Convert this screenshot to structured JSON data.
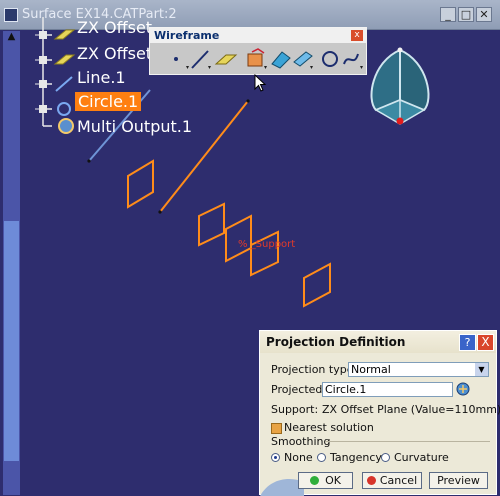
{
  "window": {
    "title": "Surface EX14.CATPart:2"
  },
  "tree": {
    "items": [
      {
        "label": "ZX Offset",
        "type": "plane"
      },
      {
        "label": "ZX Offset",
        "type": "plane"
      },
      {
        "label": "Line.1",
        "type": "line"
      },
      {
        "label": "Circle.1",
        "type": "circle",
        "selected": true
      },
      {
        "label": "Multi Output.1",
        "type": "multi-output"
      }
    ]
  },
  "toolbar": {
    "title": "Wireframe",
    "close": "x"
  },
  "viewport": {
    "support_label": "% _Support"
  },
  "dialog": {
    "title": "Projection Definition",
    "help": "?",
    "close": "X",
    "projection_type_label": "Projection type :",
    "projection_type_value": "Normal",
    "projected_label": "Projected:",
    "projected_value": "Circle.1",
    "support_label": "Support:",
    "support_value": "ZX Offset Plane (Value=110mm)",
    "nearest_label": "Nearest solution",
    "smoothing_label": "Smoothing",
    "smoothing_options": [
      "None",
      "Tangency",
      "Curvature"
    ],
    "smoothing_selected": "None",
    "ok_label": "OK",
    "cancel_label": "Cancel",
    "preview_label": "Preview"
  },
  "colors": {
    "background": "#2e2d6e",
    "highlight": "#ff7f11",
    "geometry": "#ff8c1a",
    "accent": "#6f94d6"
  }
}
